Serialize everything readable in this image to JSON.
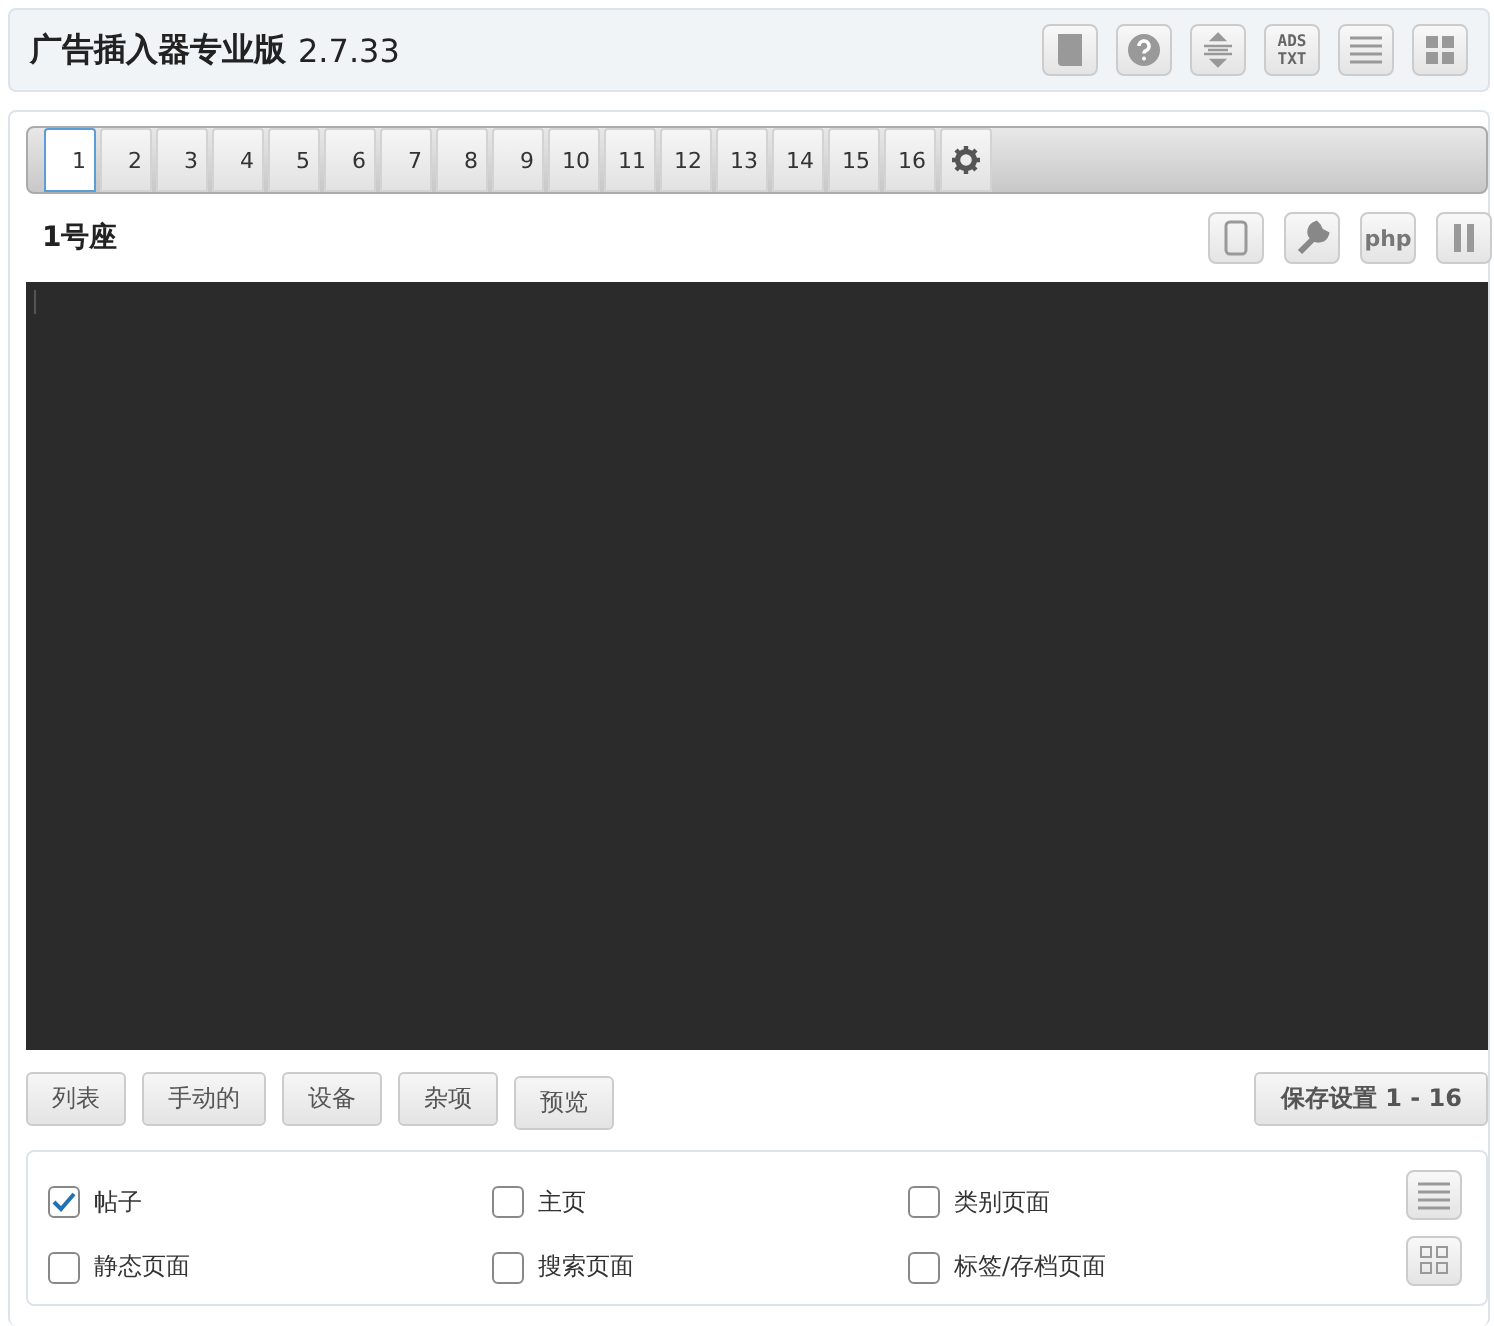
{
  "header": {
    "title": "广告插入器专业版",
    "version": "2.7.33",
    "icons": [
      {
        "kind": "book"
      },
      {
        "kind": "help"
      },
      {
        "kind": "center"
      },
      {
        "kind": "ads-txt"
      },
      {
        "kind": "list"
      },
      {
        "kind": "grid"
      }
    ],
    "ads_txt": [
      "ADS",
      "TXT"
    ]
  },
  "tabs": [
    {
      "label": "1",
      "selected": true
    },
    {
      "label": "2",
      "selected": false
    },
    {
      "label": "3",
      "selected": false
    },
    {
      "label": "4",
      "selected": false
    },
    {
      "label": "5",
      "selected": false
    },
    {
      "label": "6",
      "selected": false
    },
    {
      "label": "7",
      "selected": false
    },
    {
      "label": "8",
      "selected": false
    },
    {
      "label": "9",
      "selected": false
    },
    {
      "label": "10",
      "selected": false
    },
    {
      "label": "11",
      "selected": false
    },
    {
      "label": "12",
      "selected": false
    },
    {
      "label": "13",
      "selected": false
    },
    {
      "label": "14",
      "selected": false
    },
    {
      "label": "15",
      "selected": false
    },
    {
      "label": "16",
      "selected": false
    }
  ],
  "block": {
    "name": "1号座",
    "php_label": "php"
  },
  "buttons": [
    "列表",
    "手动的",
    "设备",
    "杂项",
    "预览"
  ],
  "save_button": "保存设置 1 - 16",
  "options": [
    {
      "label": "帖子",
      "checked": true
    },
    {
      "label": "主页",
      "checked": false
    },
    {
      "label": "类别页面",
      "checked": false
    },
    {
      "label": "静态页面",
      "checked": false
    },
    {
      "label": "搜索页面",
      "checked": false
    },
    {
      "label": "标签/存档页面",
      "checked": false
    }
  ]
}
